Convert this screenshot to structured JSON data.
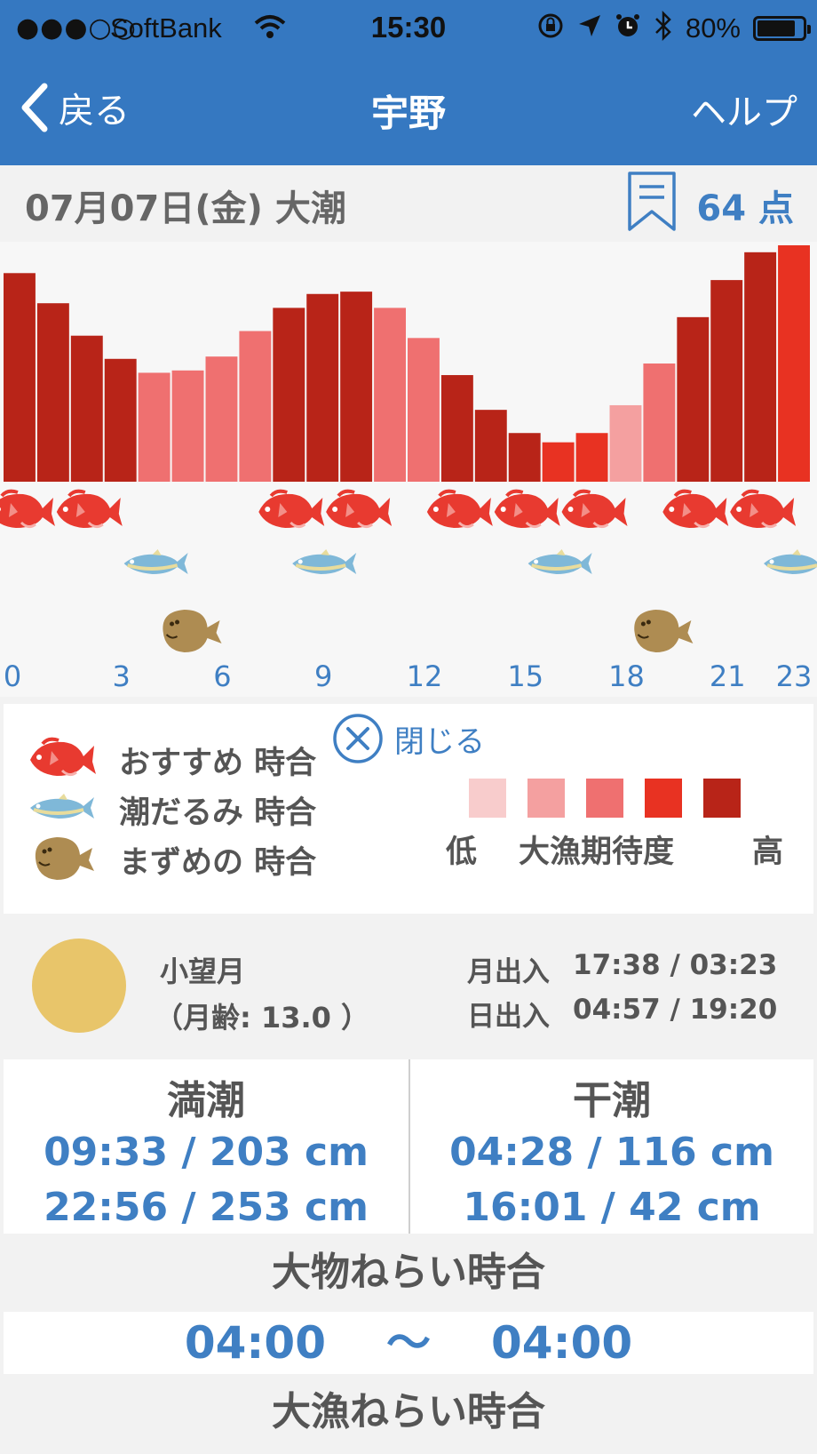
{
  "status_bar": {
    "signal": "●●●○○",
    "carrier": "SoftBank",
    "time": "15:30",
    "battery_pct": "80%",
    "battery_level": 0.8,
    "icons": [
      "wifi-icon",
      "orientation-lock-icon",
      "location-arrow-icon",
      "alarm-icon",
      "bluetooth-icon",
      "battery-icon"
    ]
  },
  "nav": {
    "back_label": "戻る",
    "title": "宇野",
    "help_label": "ヘルプ"
  },
  "header": {
    "date": "07月07日(金) 大潮",
    "score": "64 点"
  },
  "chart_data": {
    "type": "bar",
    "categories": [
      0,
      1,
      2,
      3,
      4,
      5,
      6,
      7,
      8,
      9,
      10,
      11,
      12,
      13,
      14,
      15,
      16,
      17,
      18,
      19,
      20,
      21,
      22,
      23
    ],
    "values": [
      90,
      77,
      63,
      53,
      47,
      48,
      54,
      65,
      75,
      81,
      82,
      75,
      62,
      46,
      31,
      21,
      17,
      21,
      33,
      51,
      71,
      87,
      99,
      102
    ],
    "levels": [
      4,
      4,
      4,
      4,
      2,
      2,
      2,
      2,
      4,
      4,
      4,
      2,
      2,
      4,
      4,
      4,
      3,
      3,
      1,
      2,
      4,
      4,
      4,
      3
    ],
    "level_colors": [
      "#f8cccc",
      "#f4a0a0",
      "#ef7070",
      "#e83222",
      "#b82418"
    ],
    "x_tick_labels": [
      "0",
      "3",
      "6",
      "9",
      "12",
      "15",
      "18",
      "21",
      "23"
    ],
    "x_ticks": [
      0,
      3,
      6,
      9,
      12,
      15,
      18,
      21,
      23
    ],
    "recommended_hours": [
      0,
      2,
      8,
      10,
      13,
      15,
      17,
      20,
      22
    ],
    "slack_tide_hours": [
      4,
      9,
      16,
      23
    ],
    "twilight_hours": [
      5,
      19
    ]
  },
  "legend": {
    "close_label": "閉じる",
    "items": [
      {
        "label": "おすすめ 時合",
        "icon": "snapper-icon"
      },
      {
        "label": "潮だるみ 時合",
        "icon": "horse-mackerel-icon"
      },
      {
        "label": "まずめの 時合",
        "icon": "flatfish-icon"
      }
    ],
    "scale_low": "低",
    "scale_mid": "大漁期待度",
    "scale_high": "高"
  },
  "moon": {
    "name": "小望月",
    "age": "（月齢: 13.0 ）",
    "moon_label": "月出入",
    "moon_times": "17:38 / 03:23",
    "sun_label": "日出入",
    "sun_times": "04:57 / 19:20"
  },
  "tide": {
    "high_label": "満潮",
    "high": [
      "09:33 / 203 cm",
      "22:56 / 253 cm"
    ],
    "low_label": "干潮",
    "low": [
      "04:28 / 116 cm",
      "16:01 / 42 cm"
    ]
  },
  "big_game": {
    "title": "大物ねらい時合",
    "start": "04:00",
    "sep": "〜",
    "end": "04:00"
  },
  "big_catch": {
    "title": "大漁ねらい時合"
  }
}
